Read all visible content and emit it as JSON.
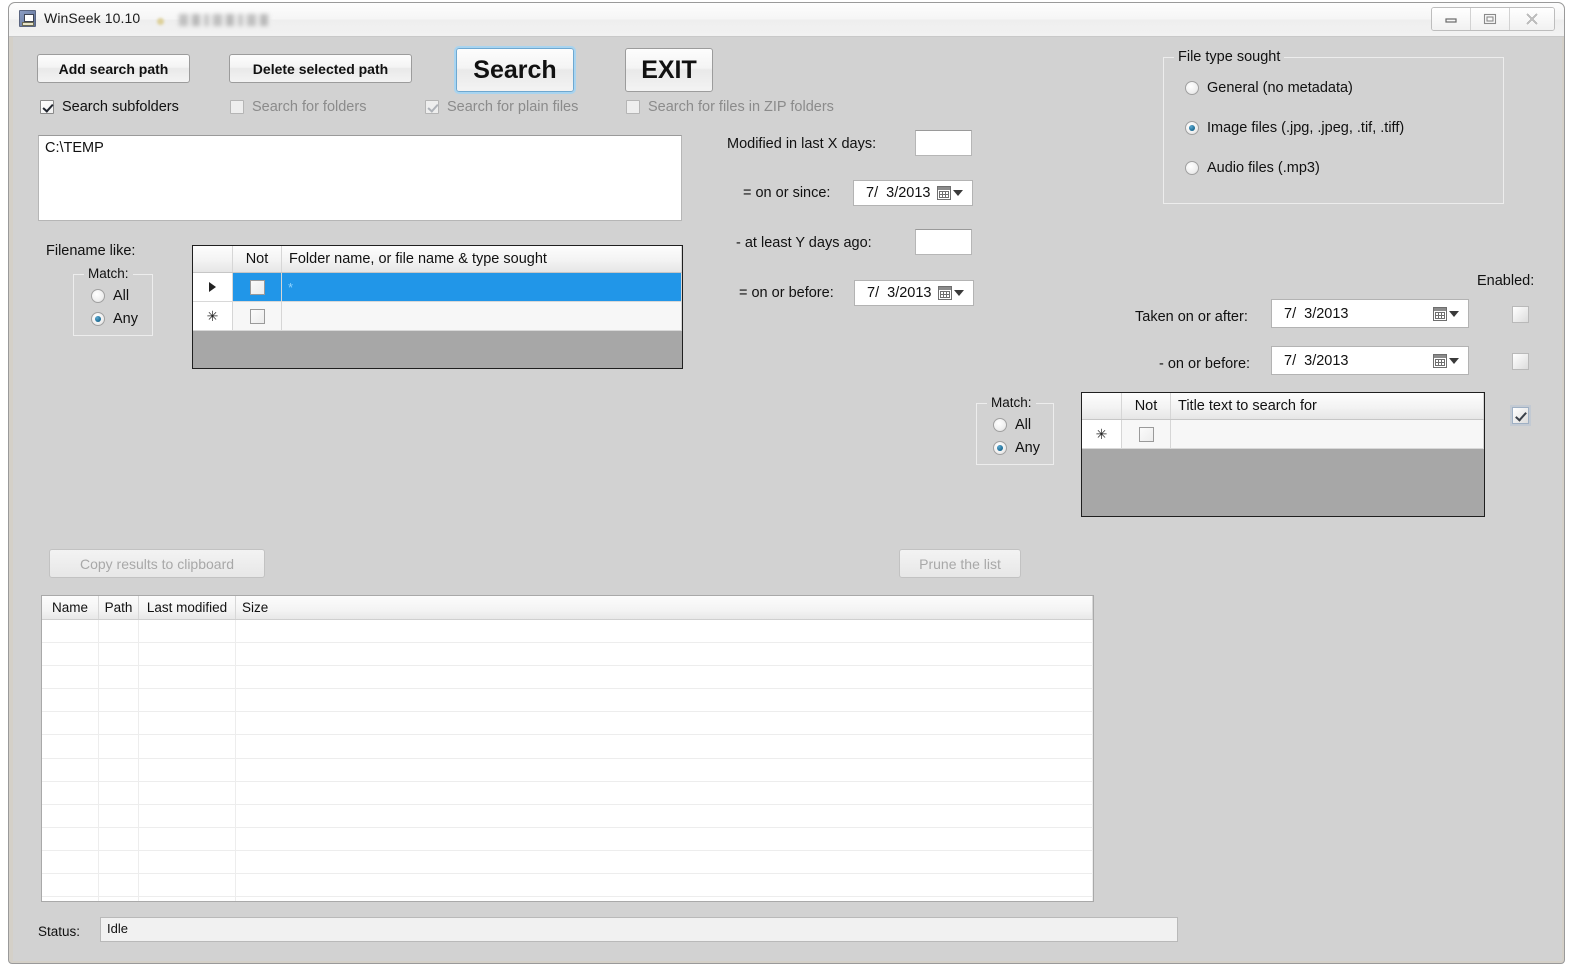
{
  "window": {
    "title": "WinSeek  10.10",
    "icon": "app-icon",
    "controls": {
      "minimize": "minimize-icon",
      "maximize": "maximize-icon",
      "close": "close-icon"
    }
  },
  "toolbar": {
    "add_path_label": "Add search path",
    "delete_path_label": "Delete selected path",
    "search_label": "Search",
    "exit_label": "EXIT",
    "checkboxes": [
      {
        "label": "Search subfolders",
        "checked": true,
        "enabled": true
      },
      {
        "label": "Search for folders",
        "checked": false,
        "enabled": false
      },
      {
        "label": "Search for plain files",
        "checked": true,
        "enabled": false
      },
      {
        "label": "Search for files in ZIP folders",
        "checked": false,
        "enabled": false
      }
    ]
  },
  "paths": {
    "value": "C:\\TEMP"
  },
  "filename_filter": {
    "label": "Filename like:",
    "match_group_title": "Match:",
    "match_all_label": "All",
    "match_any_label": "Any",
    "match_selected": "Any",
    "grid": {
      "columns": [
        "",
        "Not",
        "Folder name, or file name & type sought"
      ],
      "rows": [
        {
          "marker": "▶",
          "not": false,
          "text": "*",
          "selected": true
        },
        {
          "marker": "✳",
          "not": false,
          "text": "",
          "selected": false
        }
      ]
    }
  },
  "date_modified": {
    "modified_in_last_label": "Modified in last X days:",
    "modified_in_last_value": "",
    "on_or_since_label": "=  on or since:",
    "on_or_since_value": "7/  3/2013",
    "at_least_label": "- at least Y days ago:",
    "at_least_value": "",
    "on_or_before_label": "=  on or before:",
    "on_or_before_value": "7/  3/2013"
  },
  "file_type": {
    "group_title": "File type sought",
    "options": [
      {
        "label": "General (no metadata)",
        "selected": false
      },
      {
        "label": "Image files (.jpg,  .jpeg,  .tif,  .tiff)",
        "selected": true
      },
      {
        "label": "Audio files (.mp3)",
        "selected": false
      }
    ]
  },
  "taken_dates": {
    "enabled_header": "Enabled:",
    "taken_on_or_after_label": "Taken on or after:",
    "taken_on_or_after_value": "7/  3/2013",
    "taken_on_or_after_enabled": false,
    "on_or_before_label": "- on or before:",
    "on_or_before_value": "7/  3/2013",
    "on_or_before_enabled": false,
    "title_grid_enabled": true
  },
  "title_filter": {
    "match_group_title": "Match:",
    "match_all_label": "All",
    "match_any_label": "Any",
    "match_selected": "Any",
    "grid": {
      "columns": [
        "",
        "Not",
        "Title text to search for"
      ],
      "rows": [
        {
          "marker": "✳",
          "not": false,
          "text": "",
          "selected": false
        }
      ]
    }
  },
  "results": {
    "copy_button_label": "Copy results to clipboard",
    "copy_button_enabled": false,
    "prune_button_label": "Prune the list",
    "prune_button_enabled": false,
    "columns": [
      "Name",
      "Path",
      "Last modified",
      "Size"
    ],
    "rows": [],
    "empty_row_count": 13
  },
  "status": {
    "label": "Status:",
    "value": "Idle"
  },
  "colors": {
    "window_bg": "#d2d2d2",
    "selection_blue": "#2196e8",
    "grid_filler": "#a7a7a7",
    "focus_ring": "#a8d4f0"
  }
}
